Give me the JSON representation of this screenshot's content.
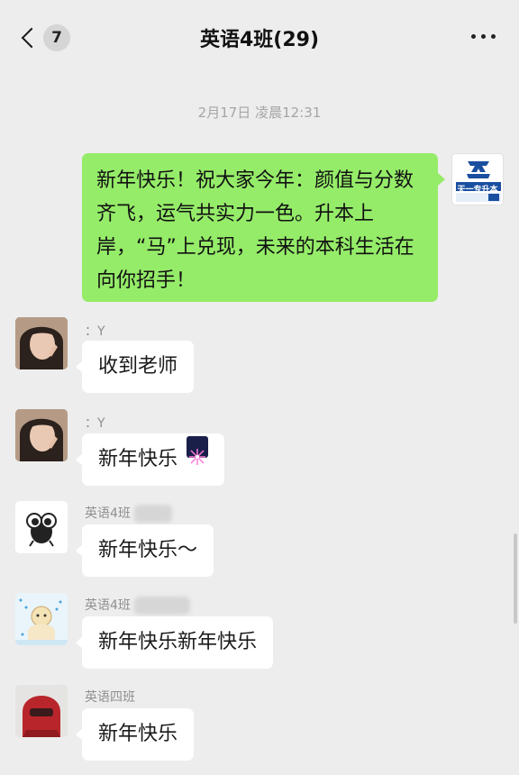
{
  "header": {
    "unread_count": "7",
    "title": "英语4班(29)"
  },
  "timestamp": "2月17日 凌晨12:31",
  "outgoing": {
    "text": "新年快乐！祝大家今年：颜值与分数齐飞，运气共实力一色。升本上岸，“马”上兑现，未来的本科生活在向你招手！",
    "avatar_logo_text": "天一专升本"
  },
  "messages": [
    {
      "sender": "：Y",
      "text": "收到老师"
    },
    {
      "sender": "：Y",
      "text": "新年快乐"
    },
    {
      "sender": "英语4班",
      "text": "新年快乐～"
    },
    {
      "sender": "英语4班",
      "text": "新年快乐新年快乐"
    },
    {
      "sender": "英语四班",
      "text": "新年快乐"
    }
  ],
  "icons": {
    "back": "chevron-left-icon",
    "more": "more-dots-icon",
    "firework": "firework-emoji-icon"
  },
  "colors": {
    "background": "#ededed",
    "outgoing_bubble": "#95ec69",
    "incoming_bubble": "#ffffff"
  }
}
